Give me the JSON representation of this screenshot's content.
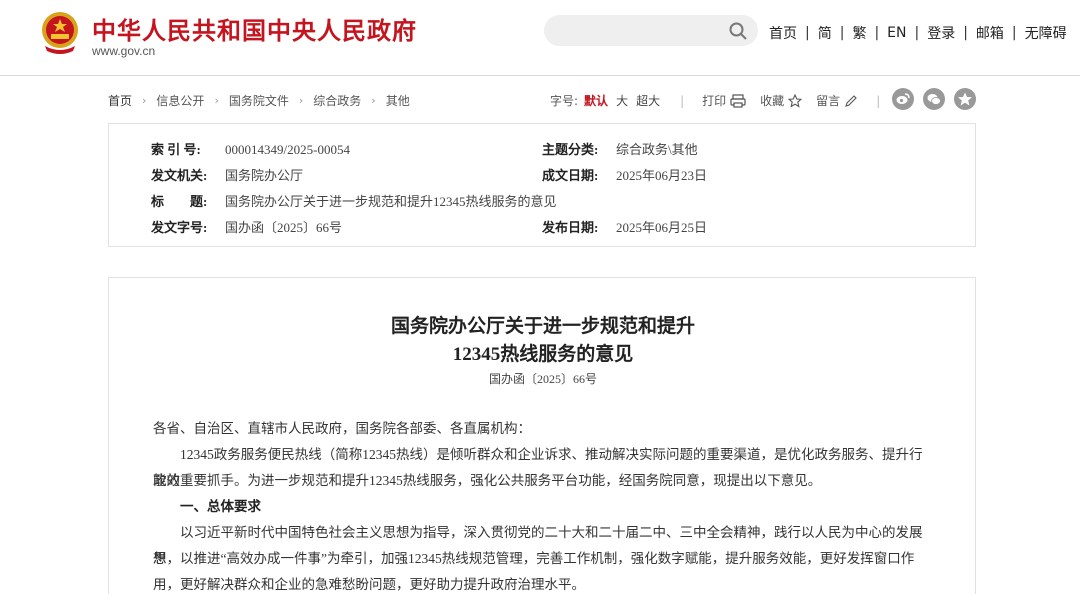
{
  "header": {
    "site_title": "中华人民共和国中央人民政府",
    "site_url": "www.gov.cn",
    "search_placeholder": "",
    "nav": [
      "首页",
      "简",
      "繁",
      "EN",
      "登录",
      "邮箱",
      "无障碍"
    ]
  },
  "breadcrumb": [
    "首页",
    "信息公开",
    "国务院文件",
    "综合政务",
    "其他"
  ],
  "tools": {
    "font_label": "字号:",
    "font_sizes": [
      "默认",
      "大",
      "超大"
    ],
    "print": "打印",
    "favorite": "收藏",
    "comment": "留言"
  },
  "info": {
    "index_key": "索 引 号:",
    "index_val": "000014349/2025-00054",
    "topic_key": "主题分类:",
    "topic_val": "综合政务\\其他",
    "issuer_key": "发文机关:",
    "issuer_val": "国务院办公厅",
    "date_made_key": "成文日期:",
    "date_made_val": "2025年06月23日",
    "title_key": "标　　题:",
    "title_val": "国务院办公厅关于进一步规范和提升12345热线服务的意见",
    "docno_key": "发文字号:",
    "docno_val": "国办函〔2025〕66号",
    "pub_date_key": "发布日期:",
    "pub_date_val": "2025年06月25日"
  },
  "article": {
    "title_line1": "国务院办公厅关于进一步规范和提升",
    "title_line2": "12345热线服务的意见",
    "doc_no": "国办函〔2025〕66号",
    "salutation": "各省、自治区、直辖市人民政府，国务院各部委、各直属机构：",
    "para1_line1": "12345政务服务便民热线（简称12345热线）是倾听群众和企业诉求、推动解决实际问题的重要渠道，是优化政务服务、提升行政效",
    "para1_line2": "能的重要抓手。为进一步规范和提升12345热线服务，强化公共服务平台功能，经国务院同意，现提出以下意见。",
    "heading1": "一、总体要求",
    "para2_line1": "以习近平新时代中国特色社会主义思想为指导，深入贯彻党的二十大和二十届二中、三中全会精神，践行以人民为中心的发展思",
    "para2_line2": "想，以推进“高效办成一件事”为牵引，加强12345热线规范管理，完善工作机制，强化数字赋能，提升服务效能，更好发挥窗口作",
    "para2_line3": "用，更好解决群众和企业的急难愁盼问题，更好助力提升政府治理水平。"
  }
}
